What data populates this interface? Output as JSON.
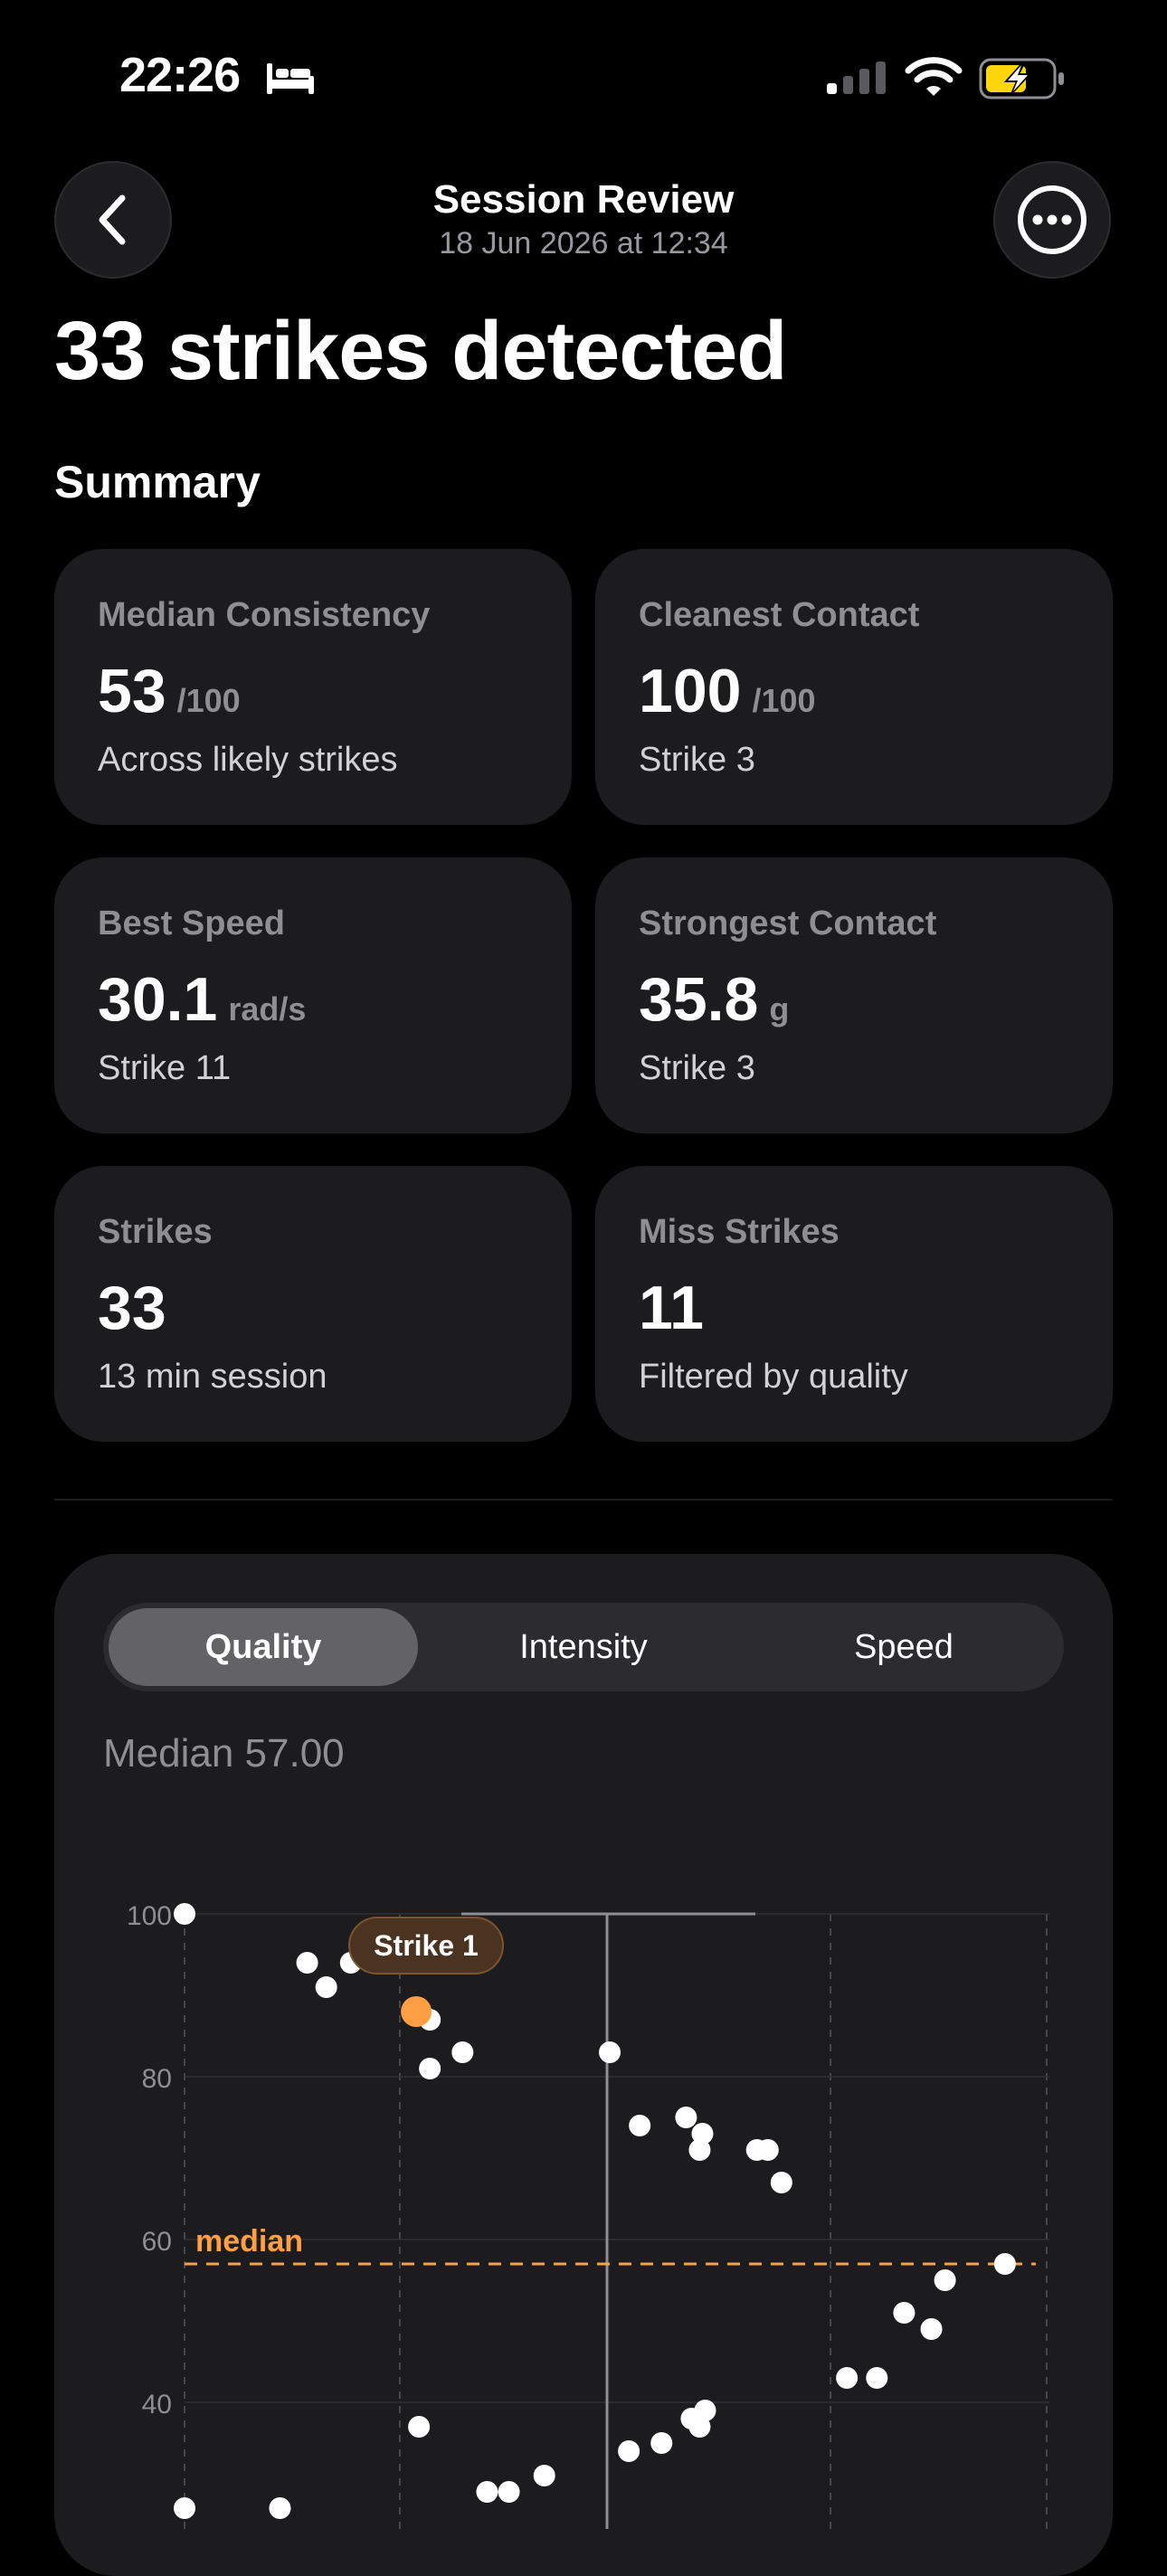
{
  "status_bar": {
    "time": "22:26"
  },
  "nav": {
    "title": "Session Review",
    "subtitle": "18 Jun 2026 at 12:34"
  },
  "headline": "33 strikes detected",
  "summary": {
    "title": "Summary",
    "cards": [
      {
        "label": "Median Consistency",
        "value": "53",
        "unit": "/100",
        "sub": "Across likely strikes"
      },
      {
        "label": "Cleanest Contact",
        "value": "100",
        "unit": "/100",
        "sub": "Strike 3"
      },
      {
        "label": "Best Speed",
        "value": "30.1",
        "unit": "rad/s",
        "sub": "Strike 11"
      },
      {
        "label": "Strongest Contact",
        "value": "35.8",
        "unit": "g",
        "sub": "Strike 3"
      },
      {
        "label": "Strikes",
        "value": "33",
        "unit": "",
        "sub": "13 min session"
      },
      {
        "label": "Miss Strikes",
        "value": "11",
        "unit": "",
        "sub": "Filtered by quality"
      }
    ]
  },
  "chart_panel": {
    "tabs": [
      {
        "label": "Quality",
        "active": true
      },
      {
        "label": "Intensity",
        "active": false
      },
      {
        "label": "Speed",
        "active": false
      }
    ],
    "median_label": "Median 57.00"
  },
  "colors": {
    "accent": "#ff9f43",
    "card": "#1c1c1e",
    "secondary_text": "#8e8e93"
  },
  "chart_data": {
    "type": "scatter",
    "y_ticks": [
      "100",
      "80",
      "60",
      "40"
    ],
    "ylim": [
      27,
      100
    ],
    "xlim": [
      0,
      31
    ],
    "median": {
      "value": 57,
      "label": "median"
    },
    "selected": {
      "label": "Strike 1",
      "x": 8.5,
      "y": 88
    },
    "selection_x": 15.5,
    "points": [
      [
        0,
        100
      ],
      [
        4.5,
        94
      ],
      [
        5.2,
        91
      ],
      [
        6.1,
        94
      ],
      [
        9.0,
        87
      ],
      [
        9.0,
        81
      ],
      [
        10.2,
        83
      ],
      [
        15.6,
        83
      ],
      [
        16.7,
        74
      ],
      [
        18.4,
        75
      ],
      [
        18.9,
        71
      ],
      [
        19.0,
        73
      ],
      [
        21.0,
        71
      ],
      [
        21.4,
        71
      ],
      [
        21.9,
        67
      ],
      [
        30.1,
        57
      ],
      [
        27.9,
        55
      ],
      [
        26.4,
        51
      ],
      [
        27.4,
        49
      ],
      [
        24.3,
        43
      ],
      [
        25.4,
        43
      ],
      [
        8.6,
        37
      ],
      [
        11.1,
        29
      ],
      [
        11.9,
        29
      ],
      [
        13.2,
        31
      ],
      [
        16.3,
        34
      ],
      [
        17.5,
        35
      ],
      [
        18.6,
        38
      ],
      [
        18.9,
        37
      ],
      [
        19.1,
        39
      ],
      [
        0,
        27
      ],
      [
        3.5,
        27
      ]
    ]
  }
}
